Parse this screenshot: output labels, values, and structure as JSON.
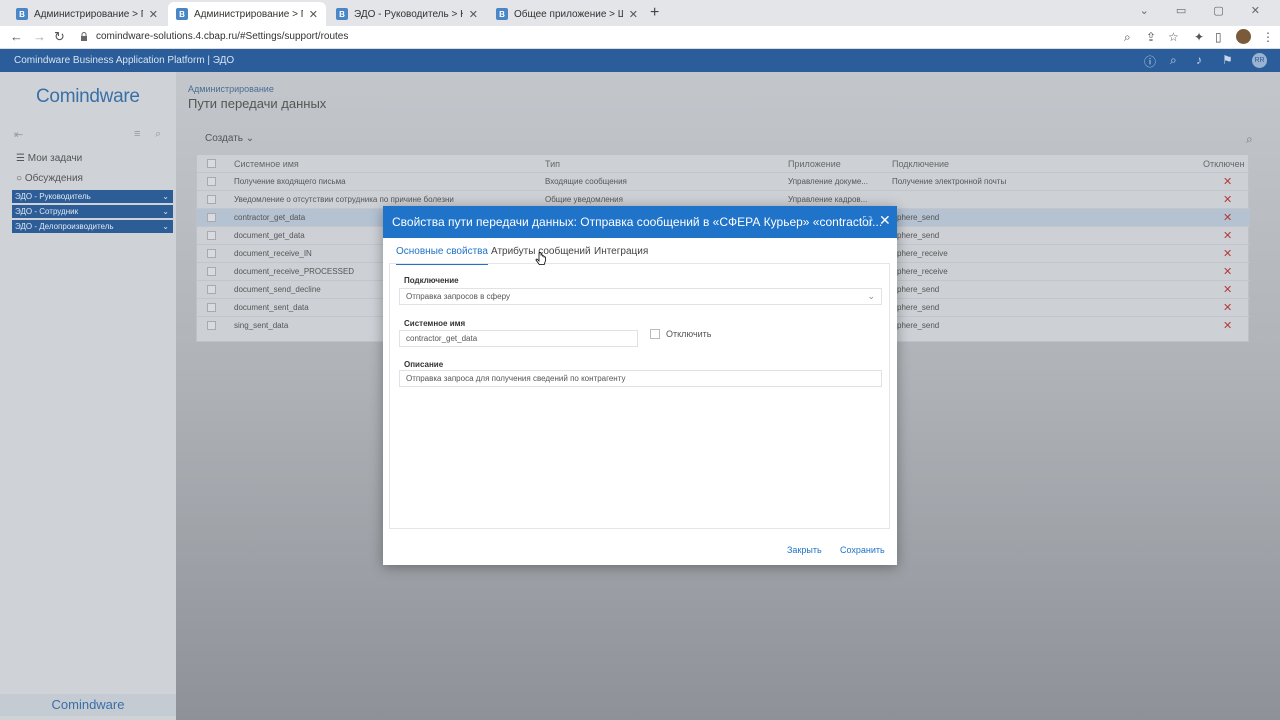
{
  "browser": {
    "tabs": [
      {
        "label": "Администрирование > Подкл",
        "fav": "B"
      },
      {
        "label": "Администрирование > Пути пе",
        "fav": "B"
      },
      {
        "label": "ЭДО - Руководитель > Контакт",
        "fav": "B"
      },
      {
        "label": "Общее приложение > Шаблон",
        "fav": "B"
      }
    ],
    "url": "comindware-solutions.4.cbap.ru/#Settings/support/routes"
  },
  "app": {
    "title": "Comindware Business Application Platform | ЭДО",
    "logo": "Comindware",
    "avatar": "RR"
  },
  "sidebar": {
    "items": [
      "Мои задачи",
      "Обсуждения"
    ],
    "groups": [
      "ЭДО - Руководитель",
      "ЭДО - Сотрудник",
      "ЭДО - Делопроизводитель"
    ],
    "footer": "Comindware"
  },
  "page": {
    "breadcrumb": "Администрирование",
    "title": "Пути передачи данных",
    "create_label": "Создать",
    "columns": [
      "Системное имя",
      "Тип",
      "Приложение",
      "Подключение",
      "Отключен"
    ],
    "rows": [
      {
        "name": "Получение входящего письма",
        "type": "Входящие сообщения",
        "app": "Управление докуме...",
        "conn": "Получение электронной почты"
      },
      {
        "name": "Уведомление о отсутствии сотрудника по причине болезни",
        "type": "Общие уведомления",
        "app": "Управление кадров...",
        "conn": ""
      },
      {
        "name": "contractor_get_data",
        "type": "",
        "app": "",
        "conn": "phere_send"
      },
      {
        "name": "document_get_data",
        "type": "",
        "app": "",
        "conn": "phere_send"
      },
      {
        "name": "document_receive_IN",
        "type": "",
        "app": "",
        "conn": "phere_receive"
      },
      {
        "name": "document_receive_PROCESSED",
        "type": "",
        "app": "",
        "conn": "phere_receive"
      },
      {
        "name": "document_send_decline",
        "type": "",
        "app": "",
        "conn": "phere_send"
      },
      {
        "name": "document_sent_data",
        "type": "",
        "app": "",
        "conn": "phere_send"
      },
      {
        "name": "sing_sent_data",
        "type": "",
        "app": "",
        "conn": "phere_send"
      }
    ]
  },
  "modal": {
    "title": "Свойства пути передачи данных: Отправка сообщений в «СФЕРА Курьер» «contractor...",
    "tabs": [
      "Основные свойства",
      "Атрибуты сообщений",
      "Интеграция"
    ],
    "connection_label": "Подключение",
    "connection_value": "Отправка запросов в сферу",
    "sysname_label": "Системное имя",
    "sysname_value": "contractor_get_data",
    "disable_label": "Отключить",
    "desc_label": "Описание",
    "desc_value": "Отправка запроса для получения сведений по контрагенту",
    "close_label": "Закрыть",
    "save_label": "Сохранить"
  },
  "colors": {
    "accent": "#1f73c9",
    "header": "#2a5d9a",
    "danger": "#b53a3a"
  }
}
